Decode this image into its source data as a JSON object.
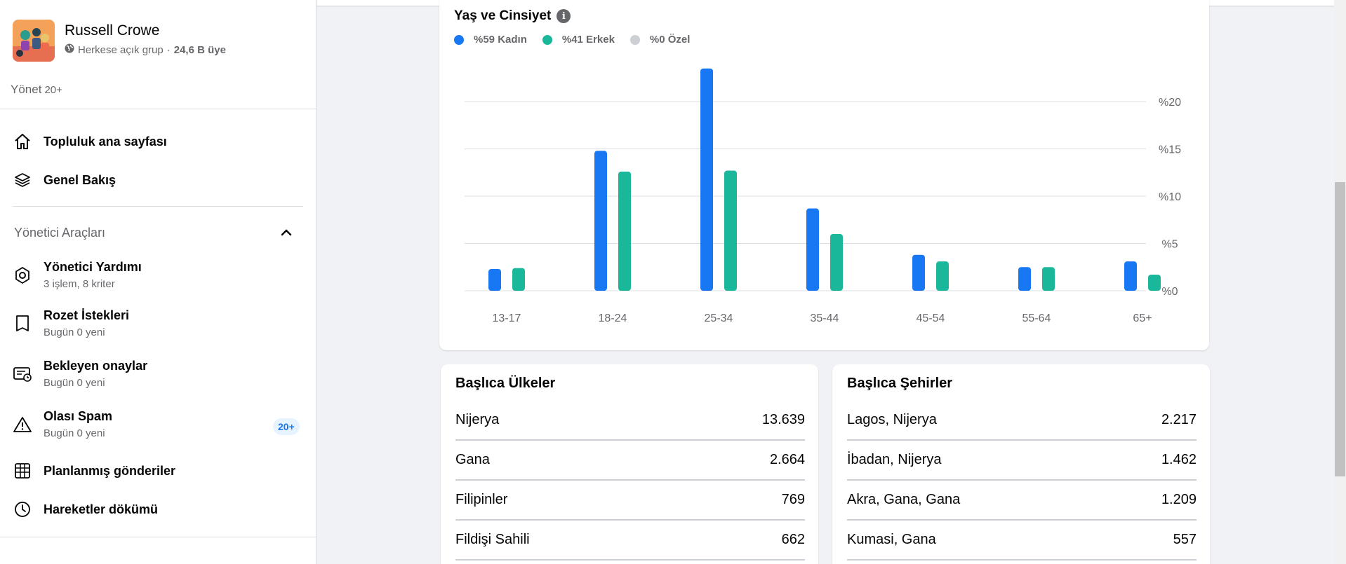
{
  "group": {
    "name": "Russell Crowe",
    "privacy": "Herkese açık grup",
    "separator": "·",
    "members": "24,6 B üye"
  },
  "manage": {
    "label": "Yönet",
    "count": "20+"
  },
  "nav": [
    {
      "title": "Topluluk ana sayfası",
      "icon": "home-icon"
    },
    {
      "title": "Genel Bakış",
      "icon": "layers-icon"
    }
  ],
  "admin_tools": {
    "title": "Yönetici Araçları",
    "items": [
      {
        "title": "Yönetici Yardımı",
        "sub": "3 işlem, 8 kriter",
        "icon": "admin-assist-icon"
      },
      {
        "title": "Rozet İstekleri",
        "sub": "Bugün 0 yeni",
        "icon": "badge-icon"
      },
      {
        "title": "Bekleyen onaylar",
        "sub": "Bugün 0 yeni",
        "icon": "pending-approvals-icon"
      },
      {
        "title": "Olası Spam",
        "sub": "Bugün 0 yeni",
        "icon": "warning-icon",
        "badge": "20+"
      },
      {
        "title": "Planlanmış gönderiler",
        "icon": "calendar-icon"
      },
      {
        "title": "Hareketler dökümü",
        "icon": "clock-icon"
      }
    ]
  },
  "chart_title": "Yaş ve Cinsiyet",
  "legend": [
    {
      "label": "%59 Kadın",
      "color": "#1877f2"
    },
    {
      "label": "%41 Erkek",
      "color": "#1bb79a"
    },
    {
      "label": "%0 Özel",
      "color": "#ccd0d5"
    }
  ],
  "chart_data": {
    "type": "bar",
    "categories": [
      "13-17",
      "18-24",
      "25-34",
      "35-44",
      "45-54",
      "55-64",
      "65+"
    ],
    "series": [
      {
        "name": "%59 Kadın",
        "values": [
          2.3,
          14.8,
          23.5,
          8.7,
          3.8,
          2.5,
          3.1
        ]
      },
      {
        "name": "%41 Erkek",
        "values": [
          2.4,
          12.6,
          12.7,
          6.0,
          3.1,
          2.5,
          1.7
        ]
      }
    ],
    "yticks": [
      "%0",
      "%5",
      "%10",
      "%15",
      "%20"
    ],
    "ylim": [
      0,
      25
    ],
    "grid": true
  },
  "countries": {
    "title": "Başlıca Ülkeler",
    "rows": [
      {
        "name": "Nijerya",
        "value": "13.639"
      },
      {
        "name": "Gana",
        "value": "2.664"
      },
      {
        "name": "Filipinler",
        "value": "769"
      },
      {
        "name": "Fildişi Sahili",
        "value": "662"
      }
    ]
  },
  "cities": {
    "title": "Başlıca Şehirler",
    "rows": [
      {
        "name": "Lagos, Nijerya",
        "value": "2.217"
      },
      {
        "name": "İbadan, Nijerya",
        "value": "1.462"
      },
      {
        "name": "Akra, Gana, Gana",
        "value": "1.209"
      },
      {
        "name": "Kumasi, Gana",
        "value": "557"
      }
    ]
  }
}
